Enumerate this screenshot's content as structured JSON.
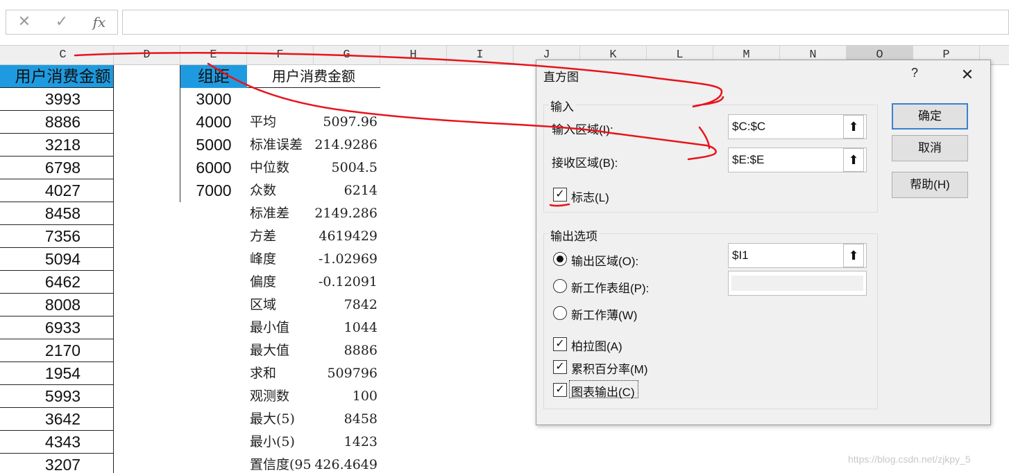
{
  "formula_bar": {
    "cancel": "✕",
    "enter": "✓",
    "fx": "fx",
    "value": ""
  },
  "columns": [
    "C",
    "D",
    "E",
    "F",
    "G",
    "H",
    "I",
    "J",
    "K",
    "L",
    "M",
    "N",
    "O",
    "P"
  ],
  "sheet": {
    "c_header": "用户消费金额",
    "c_values": [
      "3993",
      "8886",
      "3218",
      "6798",
      "4027",
      "8458",
      "7356",
      "5094",
      "6462",
      "8008",
      "6933",
      "2170",
      "1954",
      "5993",
      "3642",
      "4343",
      "3207"
    ],
    "e_header": "组距",
    "e_values": [
      "3000",
      "4000",
      "5000",
      "6000",
      "7000"
    ],
    "f_header": "用户消费金额",
    "stats": [
      {
        "label": "平均",
        "value": "5097.96"
      },
      {
        "label": "标准误差",
        "value": "214.9286"
      },
      {
        "label": "中位数",
        "value": "5004.5"
      },
      {
        "label": "众数",
        "value": "6214"
      },
      {
        "label": "标准差",
        "value": "2149.286"
      },
      {
        "label": "方差",
        "value": "4619429"
      },
      {
        "label": "峰度",
        "value": "-1.02969"
      },
      {
        "label": "偏度",
        "value": "-0.12091"
      },
      {
        "label": "区域",
        "value": "7842"
      },
      {
        "label": "最小值",
        "value": "1044"
      },
      {
        "label": "最大值",
        "value": "8886"
      },
      {
        "label": "求和",
        "value": "509796"
      },
      {
        "label": "观测数",
        "value": "100"
      },
      {
        "label": "最大(5)",
        "value": "8458"
      },
      {
        "label": "最小(5)",
        "value": "1423"
      },
      {
        "label": "置信度(95",
        "value": "426.4649"
      }
    ]
  },
  "dialog": {
    "title": "直方图",
    "help": "?",
    "close": "✕",
    "input_group": "输入",
    "input_range_label": "输入区域(I):",
    "input_range_value": "$C:$C",
    "bin_range_label": "接收区域(B):",
    "bin_range_value": "$E:$E",
    "labels_label": "标志(L)",
    "output_group": "输出选项",
    "output_range_label": "输出区域(O):",
    "output_range_value": "$I1",
    "new_sheet_label": "新工作表组(P):",
    "new_workbook_label": "新工作薄(W)",
    "pareto_label": "柏拉图(A)",
    "cumulative_label": "累积百分率(M)",
    "chart_label": "图表输出(C)",
    "ok": "确定",
    "cancel": "取消",
    "help_button": "帮助(H)",
    "range_button_glyph": "⬆",
    "check_glyph": "✓"
  },
  "watermark": "https://blog.csdn.net/zjkpy_5",
  "colors": {
    "header_blue": "#1e9be0",
    "annotation_red": "#e8131b",
    "button_focus": "#3c7fd0"
  }
}
